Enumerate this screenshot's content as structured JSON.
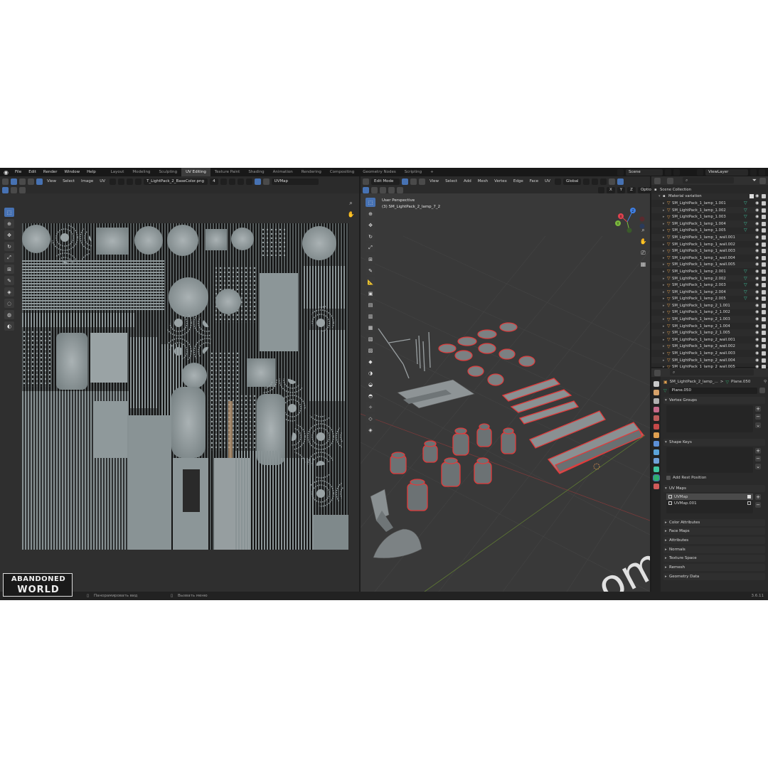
{
  "topbar": {
    "menus": [
      "File",
      "Edit",
      "Render",
      "Window",
      "Help"
    ],
    "workspaces": [
      "Layout",
      "Modeling",
      "Sculpting",
      "UV Editing",
      "Texture Paint",
      "Shading",
      "Animation",
      "Rendering",
      "Compositing",
      "Geometry Nodes",
      "Scripting"
    ],
    "active_workspace": "UV Editing",
    "add_tab": "+",
    "scene_name": "Scene",
    "view_layer": "ViewLayer"
  },
  "uv_editor": {
    "menus": [
      "View",
      "Select",
      "Image",
      "UV"
    ],
    "image_name": "T_LightPack_2_BaseColor.png",
    "user_count": "4",
    "uv_map": "UVMap"
  },
  "viewport": {
    "mode": "Edit Mode",
    "menus": [
      "View",
      "Select",
      "Add",
      "Mesh",
      "Vertex",
      "Edge",
      "Face",
      "UV"
    ],
    "orientation": "Global",
    "axis_toggles": [
      "X",
      "Y",
      "Z"
    ],
    "options_label": "Options",
    "info_line1": "User Perspective",
    "info_line2": "(3) SM_LightPack_2_lamp_7_2",
    "gizmo_axes": [
      "X",
      "Y",
      "Z"
    ],
    "watermark": "om"
  },
  "outliner": {
    "collection": "Scene Collection",
    "material_variation": "Material variation",
    "items": [
      {
        "name": "SM_LightPack_1_lamp_1.001",
        "mod": true
      },
      {
        "name": "SM_LightPack_1_lamp_1.002",
        "mod": true
      },
      {
        "name": "SM_LightPack_1_lamp_1.003",
        "mod": true
      },
      {
        "name": "SM_LightPack_1_lamp_1.004",
        "mod": true
      },
      {
        "name": "SM_LightPack_1_lamp_1.005",
        "mod": true
      },
      {
        "name": "SM_LightPack_1_lamp_1_wall.001",
        "mod": false
      },
      {
        "name": "SM_LightPack_1_lamp_1_wall.002",
        "mod": false
      },
      {
        "name": "SM_LightPack_1_lamp_1_wall.003",
        "mod": false
      },
      {
        "name": "SM_LightPack_1_lamp_1_wall.004",
        "mod": false
      },
      {
        "name": "SM_LightPack_1_lamp_1_wall.005",
        "mod": false
      },
      {
        "name": "SM_LightPack_1_lamp_2.001",
        "mod": true
      },
      {
        "name": "SM_LightPack_1_lamp_2.002",
        "mod": true
      },
      {
        "name": "SM_LightPack_1_lamp_2.003",
        "mod": true
      },
      {
        "name": "SM_LightPack_1_lamp_2.004",
        "mod": true
      },
      {
        "name": "SM_LightPack_1_lamp_2.005",
        "mod": true
      },
      {
        "name": "SM_LightPack_1_lamp_2_1.001",
        "mod": false
      },
      {
        "name": "SM_LightPack_1_lamp_2_1.002",
        "mod": false
      },
      {
        "name": "SM_LightPack_1_lamp_2_1.003",
        "mod": false
      },
      {
        "name": "SM_LightPack_1_lamp_2_1.004",
        "mod": false
      },
      {
        "name": "SM_LightPack_1_lamp_2_1.005",
        "mod": false
      },
      {
        "name": "SM_LightPack_1_lamp_2_wall.001",
        "mod": false
      },
      {
        "name": "SM_LightPack_1_lamp_2_wall.002",
        "mod": false
      },
      {
        "name": "SM_LightPack_1_lamp_2_wall.003",
        "mod": false
      },
      {
        "name": "SM_LightPack_1_lamp_2_wall.004",
        "mod": false
      },
      {
        "name": "SM_LightPack_1_lamp_2_wall.005",
        "mod": false
      }
    ]
  },
  "properties": {
    "breadcrumb_object": "SM_LightPack_2_lamp_...",
    "breadcrumb_sep": ">",
    "breadcrumb_mesh": "Plane.050",
    "mesh_name": "Plane.050",
    "vertex_groups": "Vertex Groups",
    "shape_keys": "Shape Keys",
    "add_rest_position": "Add Rest Position",
    "uv_maps": "UV Maps",
    "uv_map_items": [
      "UVMap",
      "UVMap.001"
    ],
    "collapsed_panels": [
      "Color Attributes",
      "Face Maps",
      "Attributes",
      "Normals",
      "Texture Space",
      "Remesh",
      "Geometry Data"
    ]
  },
  "statusbar": {
    "hint1": "Панорамировать вид",
    "hint2": "Вызвать меню",
    "version": "3.6.11"
  },
  "branding": {
    "line1": "ABANDONED",
    "line2": "WORLD"
  },
  "colors": {
    "accent": "#4772b3",
    "edit_outline": "#e23a3a",
    "axis_x": "#e0424f",
    "axis_y": "#7bb83d",
    "axis_z": "#3f80e6"
  }
}
